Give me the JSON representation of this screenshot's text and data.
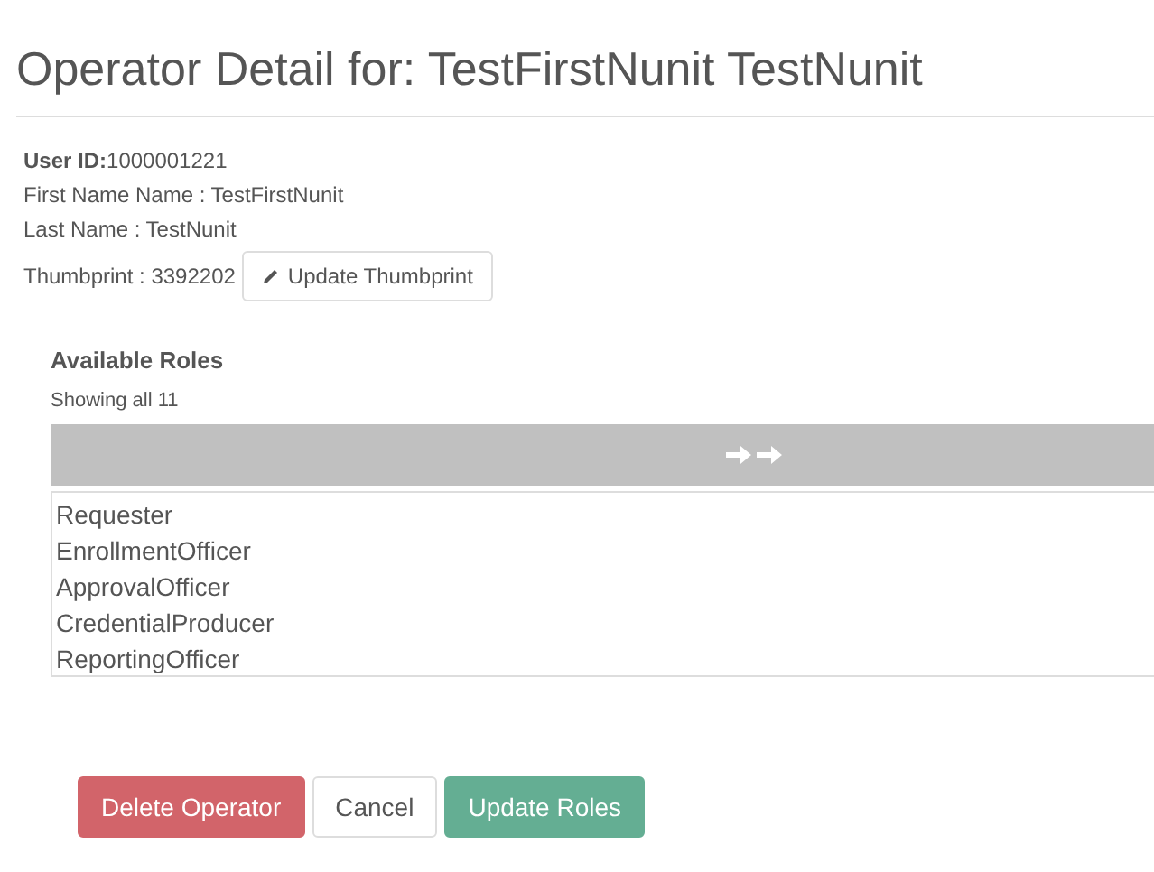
{
  "title": "Operator Detail for: TestFirstNunit TestNunit",
  "details": [
    "**User ID:**1000001221",
    "First Name Name : TestFirstNunit",
    "Last Name : TestNunit"
  ],
  "thumbprint": {
    "text": "Thumbprint : 3392202",
    "button": "Update Thumbprint"
  },
  "roles": {
    "heading": "Available Roles",
    "count": "Showing all 11",
    "items": [
      "Requester",
      "EnrollmentOfficer",
      "ApprovalOfficer",
      "CredentialProducer",
      "ReportingOfficer"
    ]
  },
  "buttons": [
    {
      "label": "Delete Operator",
      "kind": "danger"
    },
    {
      "label": "Cancel",
      "kind": "default"
    },
    {
      "label": "Update Roles",
      "kind": "success"
    }
  ]
}
